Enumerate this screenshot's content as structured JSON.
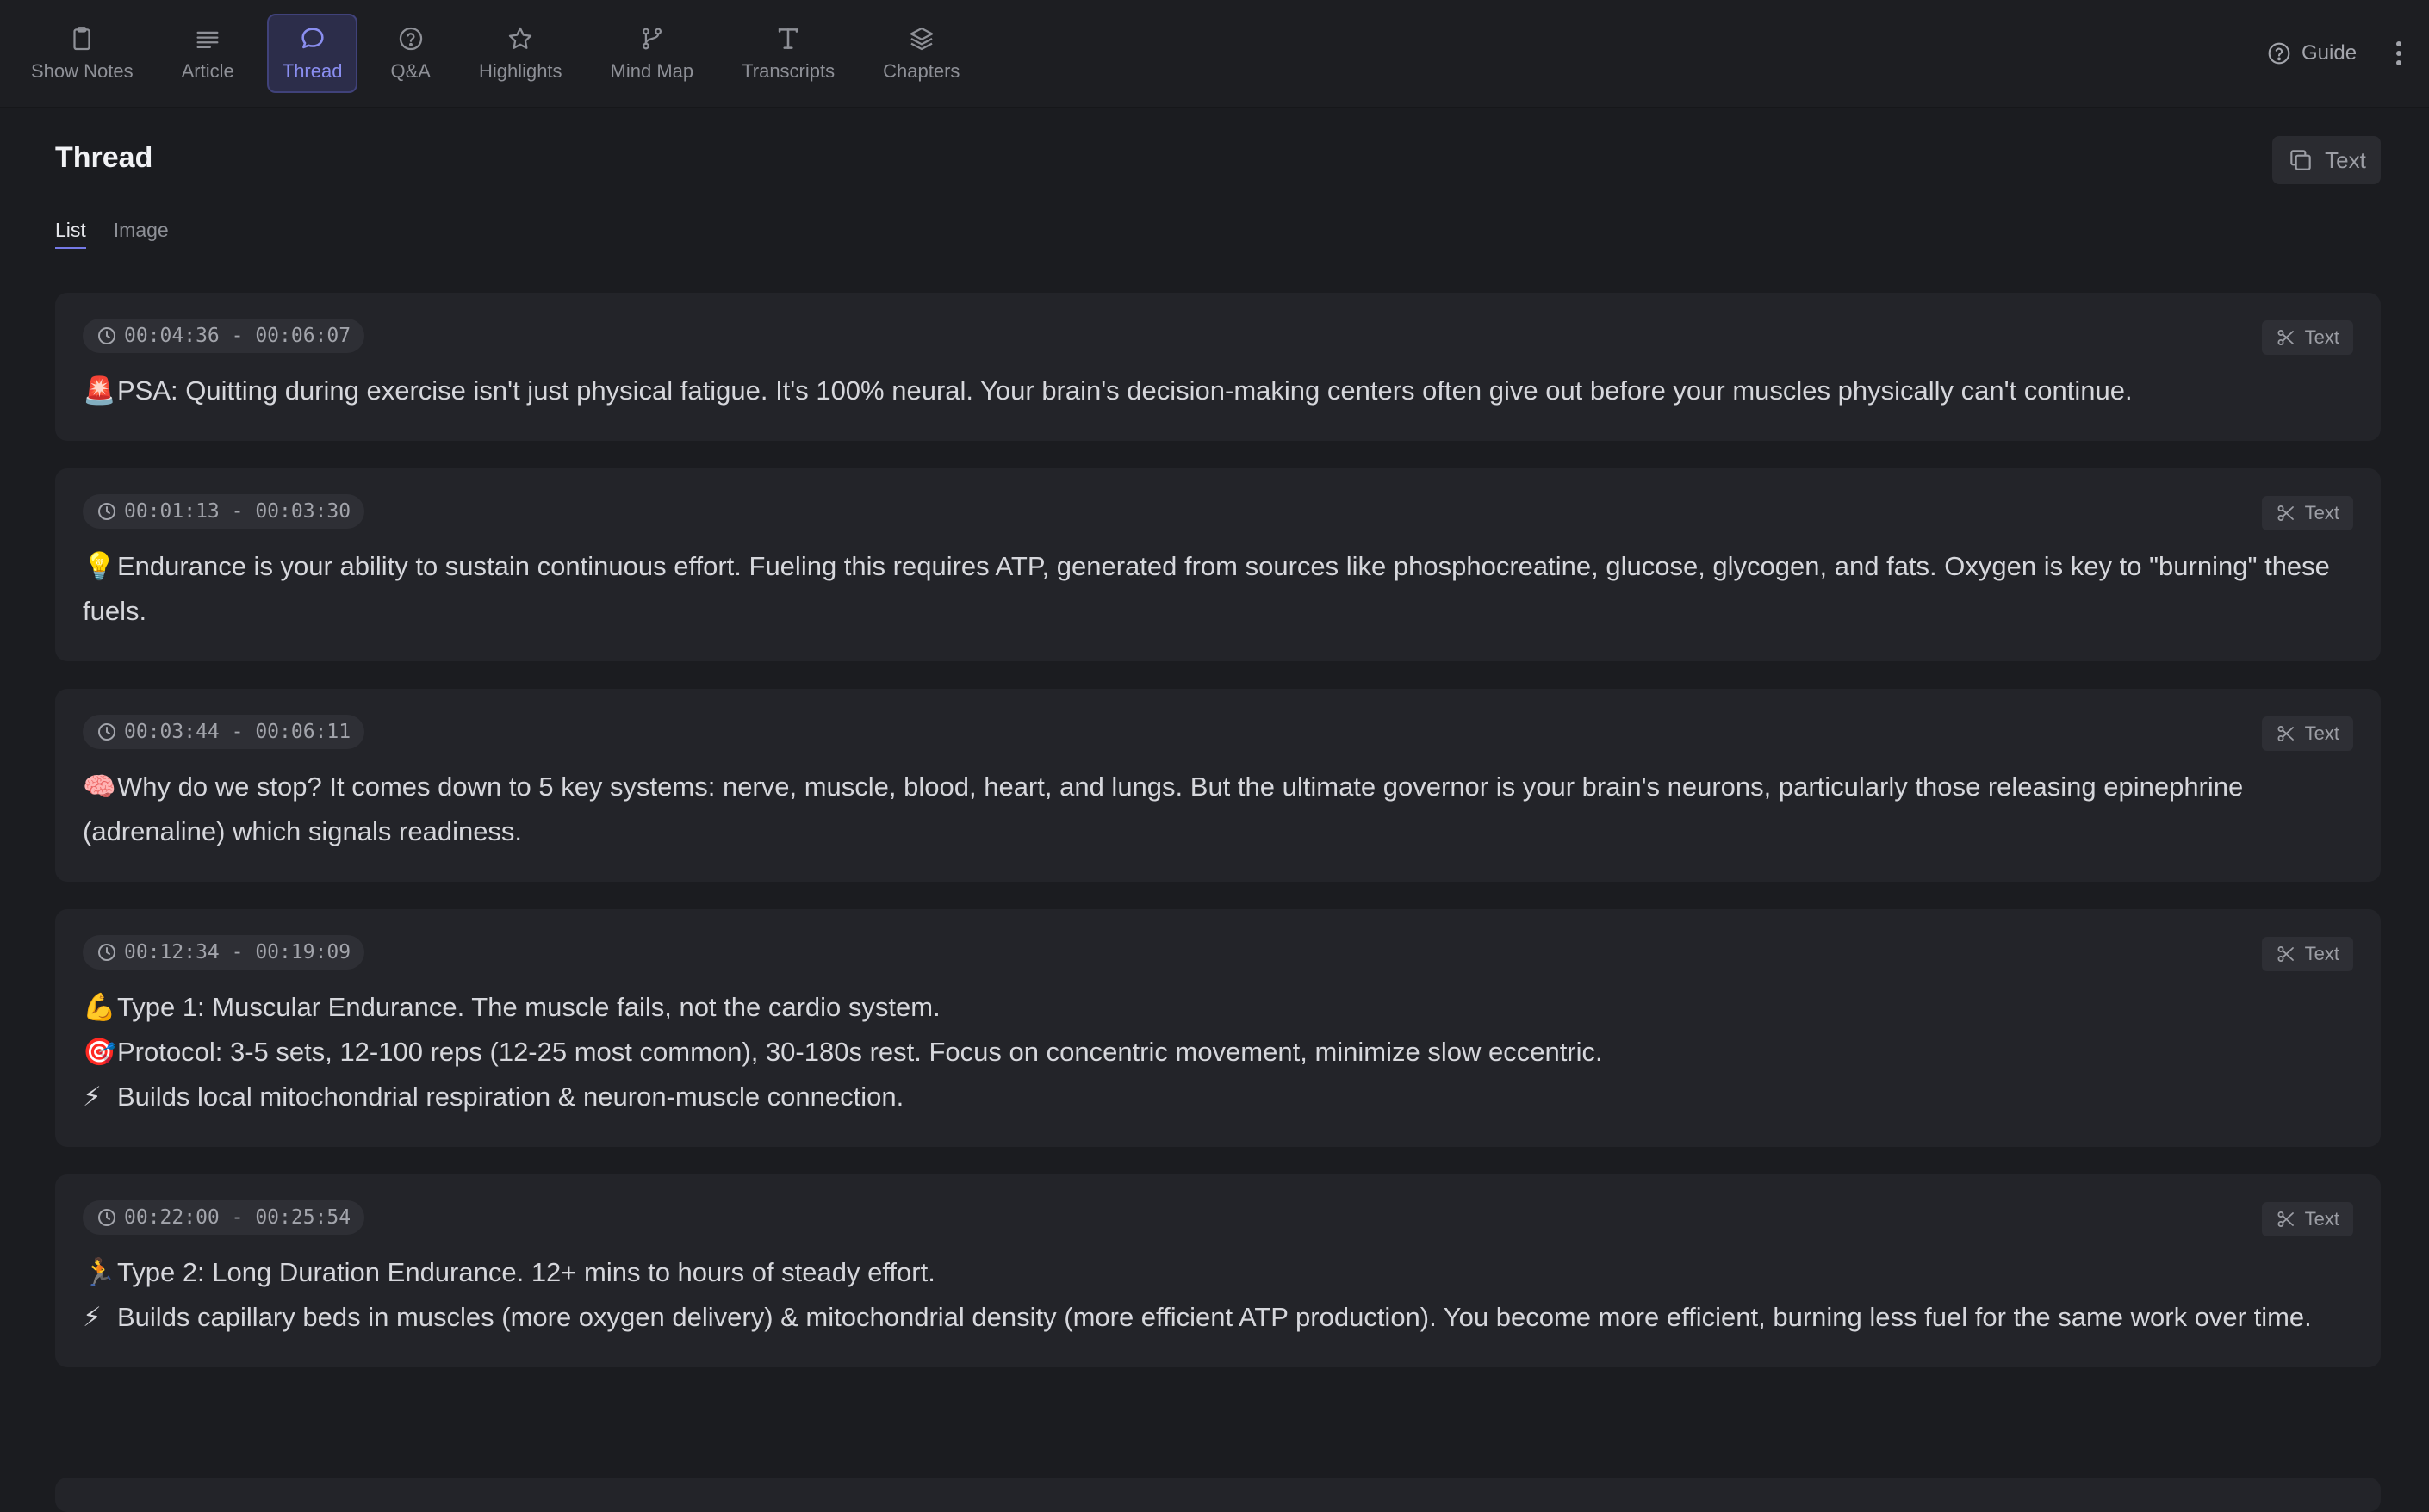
{
  "nav": {
    "items": [
      {
        "label": "Show Notes",
        "icon": "clipboard-icon"
      },
      {
        "label": "Article",
        "icon": "article-lines-icon"
      },
      {
        "label": "Thread",
        "icon": "speech-bubble-icon"
      },
      {
        "label": "Q&A",
        "icon": "question-circle-icon"
      },
      {
        "label": "Highlights",
        "icon": "star-icon"
      },
      {
        "label": "Mind Map",
        "icon": "branch-icon"
      },
      {
        "label": "Transcripts",
        "icon": "text-t-icon"
      },
      {
        "label": "Chapters",
        "icon": "layers-icon"
      }
    ],
    "active": "Thread",
    "guide_label": "Guide"
  },
  "page": {
    "title": "Thread",
    "copy_label": "Text",
    "subtabs": [
      {
        "label": "List"
      },
      {
        "label": "Image"
      }
    ],
    "active_subtab": "List"
  },
  "cards": [
    {
      "time": "00:04:36 - 00:06:07",
      "button_label": "Text",
      "lines": [
        {
          "emoji": "🚨",
          "text": "PSA: Quitting during exercise isn't just physical fatigue. It's 100% neural. Your brain's decision-making centers often give out before your muscles physically can't continue."
        }
      ]
    },
    {
      "time": "00:01:13 - 00:03:30",
      "button_label": "Text",
      "lines": [
        {
          "emoji": "💡",
          "text": "Endurance is your ability to sustain continuous effort. Fueling this requires ATP, generated from sources like phosphocreatine, glucose, glycogen, and fats. Oxygen is key to \"burning\" these fuels."
        }
      ]
    },
    {
      "time": "00:03:44 - 00:06:11",
      "button_label": "Text",
      "lines": [
        {
          "emoji": "🧠",
          "text": "Why do we stop? It comes down to 5 key systems: nerve, muscle, blood, heart, and lungs. But the ultimate governor is your brain's neurons, particularly those releasing epinephrine (adrenaline) which signals readiness."
        }
      ]
    },
    {
      "time": "00:12:34 - 00:19:09",
      "button_label": "Text",
      "lines": [
        {
          "emoji": "💪",
          "text": "Type 1: Muscular Endurance. The muscle fails, not the cardio system."
        },
        {
          "emoji": "🎯",
          "text": "Protocol: 3-5 sets, 12-100 reps (12-25 most common), 30-180s rest. Focus on concentric movement, minimize slow eccentric."
        },
        {
          "emoji": "⚡",
          "text": "Builds local mitochondrial respiration & neuron-muscle connection."
        }
      ]
    },
    {
      "time": "00:22:00 - 00:25:54",
      "button_label": "Text",
      "lines": [
        {
          "emoji": "🏃",
          "text": "Type 2: Long Duration Endurance. 12+ mins to hours of steady effort."
        },
        {
          "emoji": "⚡",
          "text": "Builds capillary beds in muscles (more oxygen delivery) & mitochondrial density (more efficient ATP production). You become more efficient, burning less fuel for the same work over time."
        }
      ]
    }
  ],
  "colors": {
    "background": "#1b1c20",
    "card": "#232429",
    "accent": "#8a8ef0"
  }
}
